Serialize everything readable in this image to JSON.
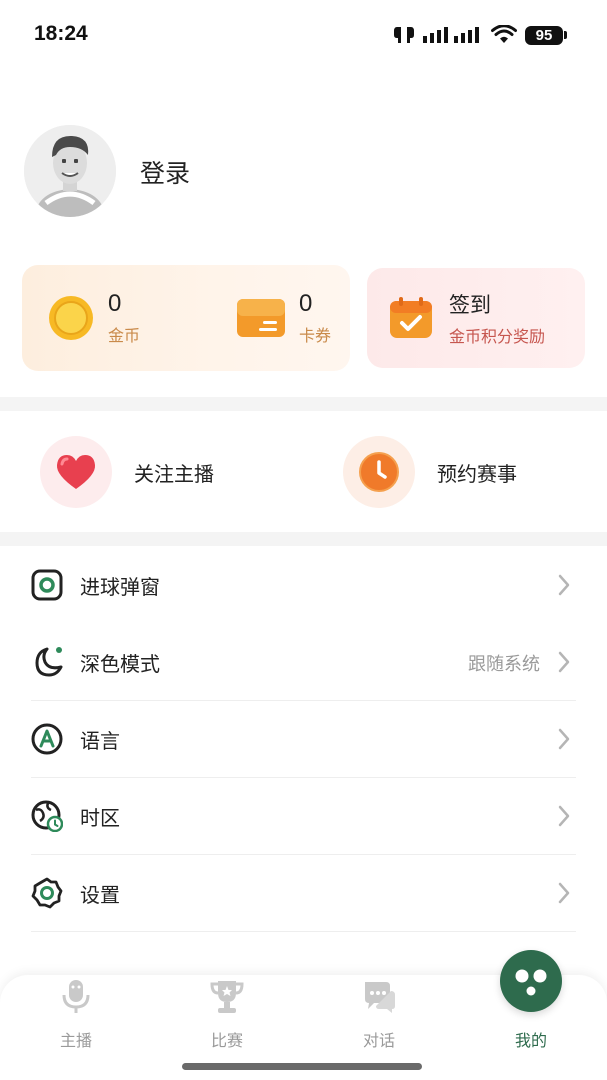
{
  "status_bar": {
    "time": "18:24",
    "battery": "95",
    "icons": [
      "dual-sim-icon",
      "signal-icon",
      "wifi-icon",
      "battery-icon"
    ]
  },
  "profile": {
    "login_label": "登录"
  },
  "wallet": {
    "coins": {
      "value": "0",
      "label": "金币",
      "icon": "gold-coin-icon"
    },
    "coupons": {
      "value": "0",
      "label": "卡券",
      "icon": "coupon-card-icon"
    }
  },
  "checkin": {
    "title": "签到",
    "subtitle": "金币积分奖励",
    "icon": "calendar-check-icon"
  },
  "quick_actions": [
    {
      "label": "关注主播",
      "icon": "heart-icon",
      "color": "#e8404f"
    },
    {
      "label": "预约赛事",
      "icon": "clock-icon",
      "color": "#f07a2a"
    }
  ],
  "menu": [
    {
      "label": "进球弹窗",
      "value": "",
      "icon": "goal-popup-icon"
    },
    {
      "label": "深色模式",
      "value": "跟随系统",
      "icon": "moon-icon"
    },
    {
      "label": "语言",
      "value": "",
      "icon": "language-icon"
    },
    {
      "label": "时区",
      "value": "",
      "icon": "timezone-globe-icon"
    },
    {
      "label": "设置",
      "value": "",
      "icon": "gear-icon"
    }
  ],
  "tabbar": {
    "tabs": [
      {
        "label": "主播",
        "icon": "microphone-icon",
        "active": false
      },
      {
        "label": "比赛",
        "icon": "trophy-icon",
        "active": false
      },
      {
        "label": "对话",
        "icon": "chat-icon",
        "active": false
      },
      {
        "label": "我的",
        "icon": "profile-face-icon",
        "active": true
      }
    ]
  },
  "colors": {
    "accent_green": "#2e6b4d",
    "coin_label": "#c98a4a",
    "checkin_sub": "#c6564f",
    "muted_text": "#9a9a9a"
  }
}
